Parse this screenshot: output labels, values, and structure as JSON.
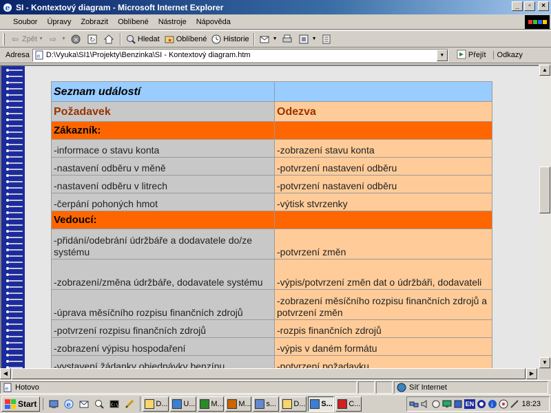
{
  "window": {
    "title": "SI - Kontextový diagram - Microsoft Internet Explorer"
  },
  "menu": [
    "Soubor",
    "Úpravy",
    "Zobrazit",
    "Oblíbené",
    "Nástroje",
    "Nápověda"
  ],
  "toolbar": {
    "back": "Zpět",
    "search": "Hledat",
    "favorites": "Oblíbené",
    "history": "Historie"
  },
  "address": {
    "label": "Adresa",
    "url": "D:\\Vyuka\\SI1\\Projekty\\Benzinka\\SI - Kontextový diagram.htm",
    "go": "Přejít",
    "links": "Odkazy"
  },
  "table": {
    "title": "Seznam událostí",
    "col_request": "Požadavek",
    "col_response": "Odezva",
    "sections": [
      {
        "name": "Zákazník:",
        "rows": [
          {
            "req": "-informace o stavu konta",
            "resp": "-zobrazení stavu konta"
          },
          {
            "req": "-nastavení odběru v měně",
            "resp": "-potvrzení nastavení odběru"
          },
          {
            "req": "-nastavení odběru v litrech",
            "resp": "-potvrzení nastavení odběru"
          },
          {
            "req": "-čerpání pohoných hmot",
            "resp": "-výtisk stvrzenky"
          }
        ]
      },
      {
        "name": "Vedoucí:",
        "rows": [
          {
            "req": "-přidání/odebrání údržbáře a dodavatele do/ze systému",
            "resp": "-potvrzení změn"
          },
          {
            "req": "-zobrazení/změna údržbáře, dodavatele systému",
            "resp": "-výpis/potvrzení změn dat o údržbáři, dodavateli"
          },
          {
            "req": "-úprava měsíčního rozpisu finančních zdrojů",
            "resp": "-zobrazení měsíčního rozpisu finančních zdrojů a potvrzení změn"
          },
          {
            "req": "-potvrzení rozpisu finančních zdrojů",
            "resp": "-rozpis finančních zdrojů"
          },
          {
            "req": "-zobrazení výpisu hospodaření",
            "resp": "-výpis v daném formátu"
          },
          {
            "req": "-vystavení žádanky objednávky benzínu",
            "resp": "-potvrzení požadavku"
          }
        ]
      }
    ]
  },
  "status": {
    "text": "Hotovo",
    "zone": "Síť Internet"
  },
  "taskbar": {
    "start": "Start",
    "tasks": [
      "D...",
      "U...",
      "M...",
      "M...",
      "s...",
      "D...",
      "S...",
      "C..."
    ],
    "language": "EN",
    "clock": "18:23"
  },
  "colors": {
    "title_row": "#99ccff",
    "section_row": "#ff6600",
    "request_cell": "#c8c8c8",
    "response_cell": "#ffcc99",
    "header_text": "#993300",
    "spiral": "#1c2b9c"
  }
}
